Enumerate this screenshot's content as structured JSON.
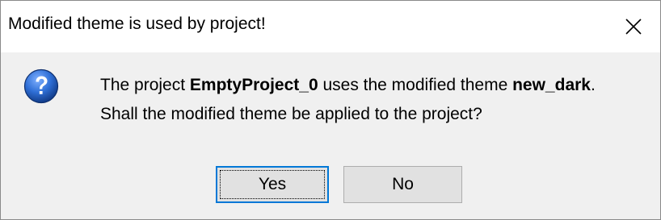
{
  "dialog": {
    "title": "Modified theme is used by project!",
    "close_icon": "close-icon",
    "icon": "question-icon",
    "message": {
      "line1_prefix": "The project ",
      "project_name": "EmptyProject_0",
      "line1_middle": " uses the modified theme ",
      "theme_name": "new_dark",
      "line1_suffix": ".",
      "line2": "Shall the modified theme be applied to the project?"
    },
    "buttons": {
      "yes_label": "Yes",
      "no_label": "No"
    },
    "colors": {
      "accent": "#0078d7",
      "content_bg": "#f0f0f0",
      "button_bg": "#e1e1e1"
    }
  }
}
